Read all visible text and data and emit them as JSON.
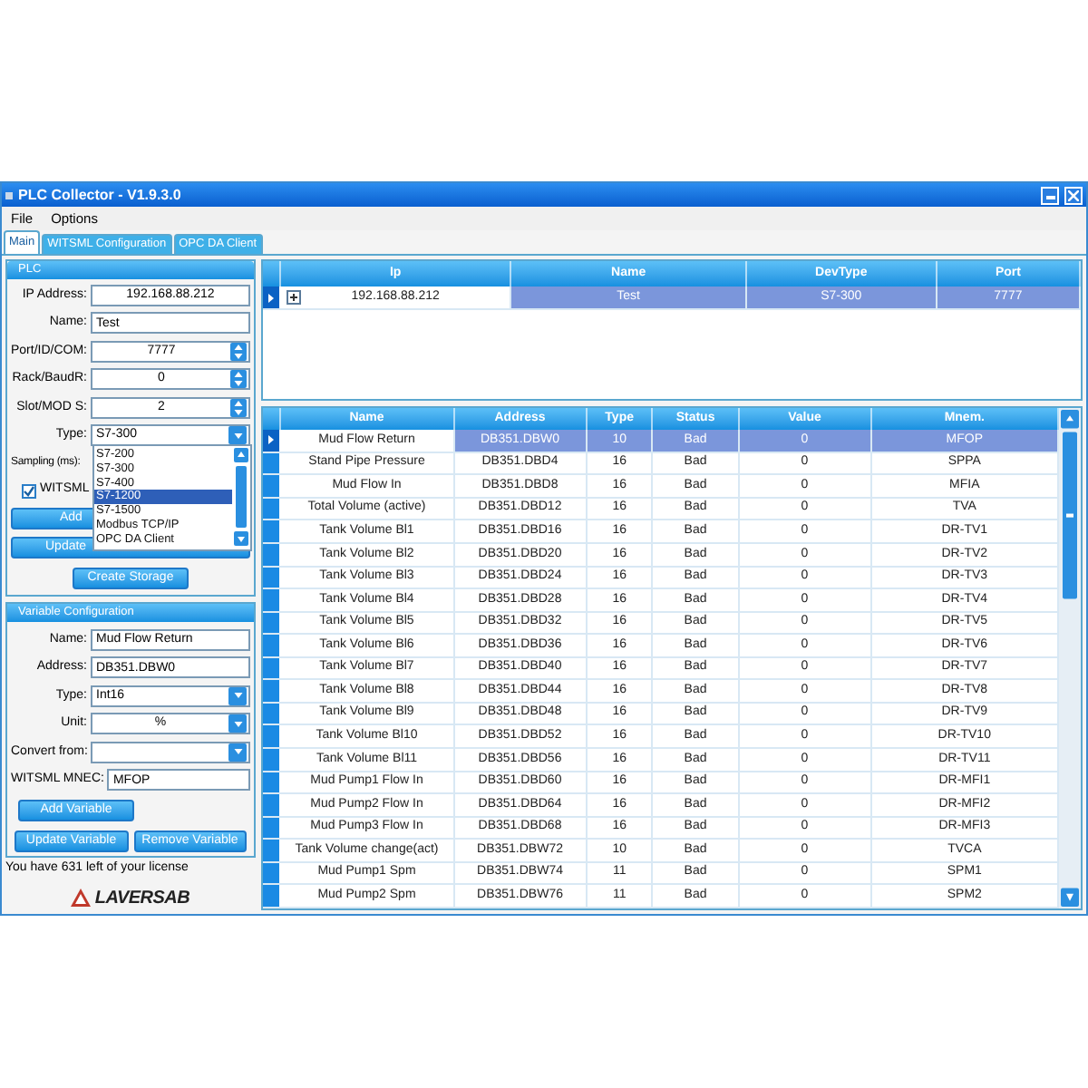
{
  "window": {
    "title": "PLC Collector - V1.9.3.0"
  },
  "menu": [
    "File",
    "Options"
  ],
  "tabs": [
    {
      "label": "Main",
      "selected": true
    },
    {
      "label": "WITSML Configuration",
      "selected": false
    },
    {
      "label": "OPC DA Client",
      "selected": false
    }
  ],
  "plc": {
    "title": "PLC",
    "fields": [
      {
        "label": "IP Address:",
        "value": "192.168.88.212",
        "kind": "text"
      },
      {
        "label": "Name:",
        "value": "Test",
        "kind": "text"
      },
      {
        "label": "Port/ID/COM:",
        "value": "7777",
        "kind": "spin"
      },
      {
        "label": "Rack/BaudR:",
        "value": "0",
        "kind": "spin"
      },
      {
        "label": "Slot/MOD S:",
        "value": "2",
        "kind": "spin"
      },
      {
        "label": "Type:",
        "value": "S7-300",
        "kind": "select"
      }
    ],
    "sampling_label": "Sampling (ms):",
    "witsml_checkbox": {
      "label": "WITSML",
      "checked": true
    },
    "add_button": "Add",
    "update_button": "Update",
    "type_dropdown": [
      {
        "label": "S7-200",
        "selected": false
      },
      {
        "label": "S7-300",
        "selected": false
      },
      {
        "label": "S7-400",
        "selected": false
      },
      {
        "label": "S7-1200",
        "selected": true
      },
      {
        "label": "S7-1500",
        "selected": false
      },
      {
        "label": "Modbus TCP/IP",
        "selected": false
      },
      {
        "label": "OPC DA Client",
        "selected": false
      }
    ],
    "create_storage_button": "Create Storage"
  },
  "variable_config": {
    "title": "Variable Configuration",
    "fields": [
      {
        "label": "Name:",
        "value": "Mud Flow Return",
        "kind": "text"
      },
      {
        "label": "Address:",
        "value": "DB351.DBW0",
        "kind": "text"
      },
      {
        "label": "Type:",
        "value": "Int16",
        "kind": "select"
      },
      {
        "label": "Unit:",
        "value": "%",
        "kind": "select_center"
      },
      {
        "label": "Convert from:",
        "kind": "select"
      },
      {
        "label": "WITSML MNEC:",
        "value": "MFOP",
        "kind": "text"
      }
    ],
    "add_button": "Add Variable",
    "update_button": "Update Variable",
    "remove_button": "Remove Variable"
  },
  "license_text": "You have 631 left of your license",
  "logo_text": "LAVERSAB",
  "devices": {
    "columns": [
      "Ip",
      "Name",
      "DevType",
      "Port"
    ],
    "rows": [
      {
        "cells": [
          "192.168.88.212",
          "Test",
          "S7-300",
          "7777"
        ],
        "selected": true
      }
    ]
  },
  "variables": {
    "columns": [
      "Name",
      "Address",
      "Type",
      "Status",
      "Value",
      "Mnem."
    ],
    "rows": [
      {
        "cells": [
          "Mud Flow Return",
          "DB351.DBW0",
          "10",
          "Bad",
          "0",
          "MFOP"
        ],
        "selected": true
      },
      {
        "cells": [
          "Stand Pipe Pressure",
          "DB351.DBD4",
          "16",
          "Bad",
          "0",
          "SPPA"
        ],
        "selected": false
      },
      {
        "cells": [
          "Mud Flow In",
          "DB351.DBD8",
          "16",
          "Bad",
          "0",
          "MFIA"
        ],
        "selected": false
      },
      {
        "cells": [
          "Total Volume (active)",
          "DB351.DBD12",
          "16",
          "Bad",
          "0",
          "TVA"
        ],
        "selected": false
      },
      {
        "cells": [
          "Tank Volume Bl1",
          "DB351.DBD16",
          "16",
          "Bad",
          "0",
          "DR-TV1"
        ],
        "selected": false
      },
      {
        "cells": [
          "Tank Volume Bl2",
          "DB351.DBD20",
          "16",
          "Bad",
          "0",
          "DR-TV2"
        ],
        "selected": false
      },
      {
        "cells": [
          "Tank Volume Bl3",
          "DB351.DBD24",
          "16",
          "Bad",
          "0",
          "DR-TV3"
        ],
        "selected": false
      },
      {
        "cells": [
          "Tank Volume Bl4",
          "DB351.DBD28",
          "16",
          "Bad",
          "0",
          "DR-TV4"
        ],
        "selected": false
      },
      {
        "cells": [
          "Tank Volume Bl5",
          "DB351.DBD32",
          "16",
          "Bad",
          "0",
          "DR-TV5"
        ],
        "selected": false
      },
      {
        "cells": [
          "Tank Volume Bl6",
          "DB351.DBD36",
          "16",
          "Bad",
          "0",
          "DR-TV6"
        ],
        "selected": false
      },
      {
        "cells": [
          "Tank Volume Bl7",
          "DB351.DBD40",
          "16",
          "Bad",
          "0",
          "DR-TV7"
        ],
        "selected": false
      },
      {
        "cells": [
          "Tank Volume Bl8",
          "DB351.DBD44",
          "16",
          "Bad",
          "0",
          "DR-TV8"
        ],
        "selected": false
      },
      {
        "cells": [
          "Tank Volume Bl9",
          "DB351.DBD48",
          "16",
          "Bad",
          "0",
          "DR-TV9"
        ],
        "selected": false
      },
      {
        "cells": [
          "Tank Volume Bl10",
          "DB351.DBD52",
          "16",
          "Bad",
          "0",
          "DR-TV10"
        ],
        "selected": false
      },
      {
        "cells": [
          "Tank Volume Bl11",
          "DB351.DBD56",
          "16",
          "Bad",
          "0",
          "DR-TV11"
        ],
        "selected": false
      },
      {
        "cells": [
          "Mud Pump1 Flow In",
          "DB351.DBD60",
          "16",
          "Bad",
          "0",
          "DR-MFI1"
        ],
        "selected": false
      },
      {
        "cells": [
          "Mud Pump2 Flow In",
          "DB351.DBD64",
          "16",
          "Bad",
          "0",
          "DR-MFI2"
        ],
        "selected": false
      },
      {
        "cells": [
          "Mud Pump3 Flow In",
          "DB351.DBD68",
          "16",
          "Bad",
          "0",
          "DR-MFI3"
        ],
        "selected": false
      },
      {
        "cells": [
          "Tank Volume change(act)",
          "DB351.DBW72",
          "10",
          "Bad",
          "0",
          "TVCA"
        ],
        "selected": false
      },
      {
        "cells": [
          "Mud Pump1 Spm",
          "DB351.DBW74",
          "11",
          "Bad",
          "0",
          "SPM1"
        ],
        "selected": false
      },
      {
        "cells": [
          "Mud Pump2 Spm",
          "DB351.DBW76",
          "11",
          "Bad",
          "0",
          "SPM2"
        ],
        "selected": false
      }
    ]
  }
}
